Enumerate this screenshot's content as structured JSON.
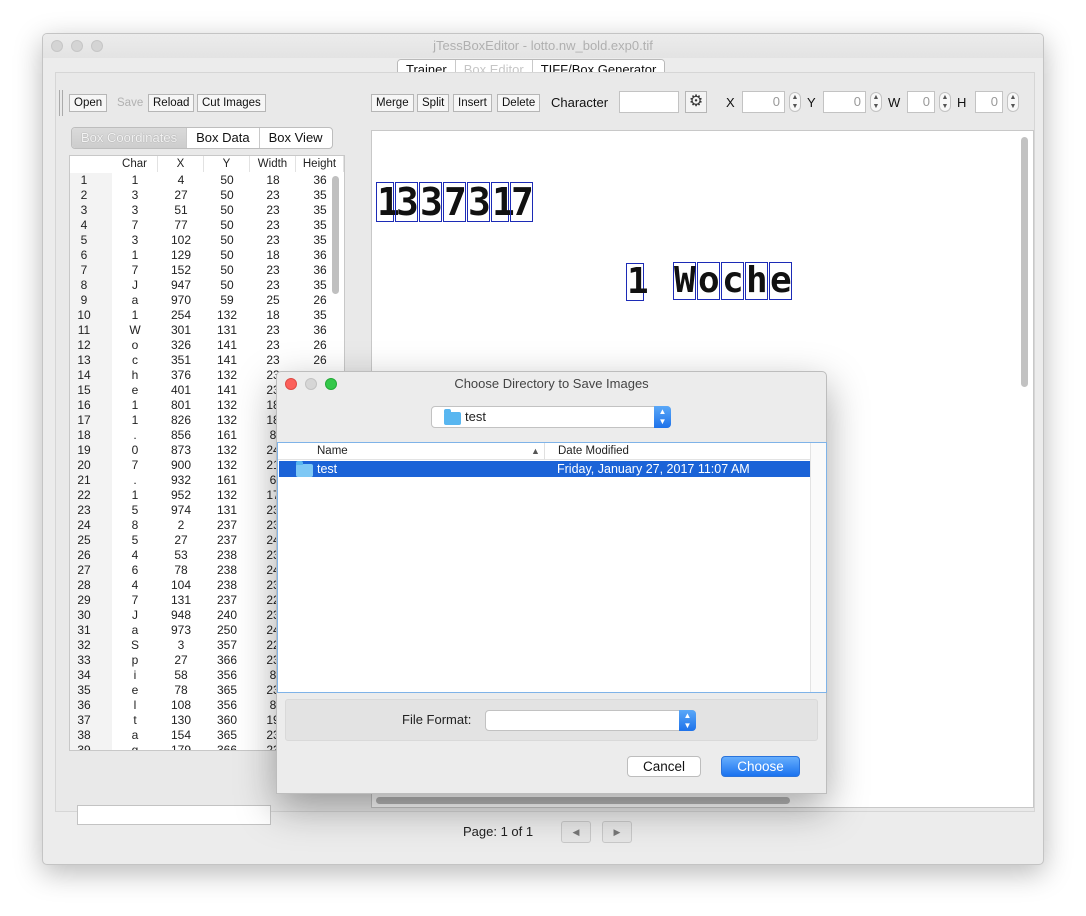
{
  "window": {
    "title": "jTessBoxEditor - lotto.nw_bold.exp0.tif"
  },
  "main_tabs": [
    {
      "label": "Trainer"
    },
    {
      "label": "Box Editor"
    },
    {
      "label": "TIFF/Box Generator"
    }
  ],
  "toolbar": {
    "open": "Open",
    "save": "Save",
    "reload": "Reload",
    "cut_images": "Cut Images",
    "merge": "Merge",
    "split": "Split",
    "insert": "Insert",
    "delete": "Delete",
    "character_label": "Character",
    "character_value": "",
    "settings_icon": "gear-icon",
    "x_label": "X",
    "x_value": "0",
    "y_label": "Y",
    "y_value": "0",
    "w_label": "W",
    "w_value": "0",
    "h_label": "H",
    "h_value": "0"
  },
  "left_tabs": [
    {
      "label": "Box Coordinates"
    },
    {
      "label": "Box Data"
    },
    {
      "label": "Box View"
    }
  ],
  "table": {
    "columns": [
      "Char",
      "X",
      "Y",
      "Width",
      "Height"
    ],
    "rows": [
      [
        "1",
        "1",
        "4",
        "50",
        "18",
        "36"
      ],
      [
        "2",
        "3",
        "27",
        "50",
        "23",
        "35"
      ],
      [
        "3",
        "3",
        "51",
        "50",
        "23",
        "35"
      ],
      [
        "4",
        "7",
        "77",
        "50",
        "23",
        "35"
      ],
      [
        "5",
        "3",
        "102",
        "50",
        "23",
        "35"
      ],
      [
        "6",
        "1",
        "129",
        "50",
        "18",
        "36"
      ],
      [
        "7",
        "7",
        "152",
        "50",
        "23",
        "36"
      ],
      [
        "8",
        "J",
        "947",
        "50",
        "23",
        "35"
      ],
      [
        "9",
        "a",
        "970",
        "59",
        "25",
        "26"
      ],
      [
        "10",
        "1",
        "254",
        "132",
        "18",
        "35"
      ],
      [
        "11",
        "W",
        "301",
        "131",
        "23",
        "36"
      ],
      [
        "12",
        "o",
        "326",
        "141",
        "23",
        "26"
      ],
      [
        "13",
        "c",
        "351",
        "141",
        "23",
        "26"
      ],
      [
        "14",
        "h",
        "376",
        "132",
        "23",
        ""
      ],
      [
        "15",
        "e",
        "401",
        "141",
        "23",
        ""
      ],
      [
        "16",
        "1",
        "801",
        "132",
        "18",
        ""
      ],
      [
        "17",
        "1",
        "826",
        "132",
        "18",
        ""
      ],
      [
        "18",
        ".",
        "856",
        "161",
        "8",
        ""
      ],
      [
        "19",
        "0",
        "873",
        "132",
        "24",
        ""
      ],
      [
        "20",
        "7",
        "900",
        "132",
        "21",
        ""
      ],
      [
        "21",
        ".",
        "932",
        "161",
        "6",
        ""
      ],
      [
        "22",
        "1",
        "952",
        "132",
        "17",
        ""
      ],
      [
        "23",
        "5",
        "974",
        "131",
        "23",
        ""
      ],
      [
        "24",
        "8",
        "2",
        "237",
        "23",
        ""
      ],
      [
        "25",
        "5",
        "27",
        "237",
        "24",
        ""
      ],
      [
        "26",
        "4",
        "53",
        "238",
        "23",
        ""
      ],
      [
        "27",
        "6",
        "78",
        "238",
        "24",
        ""
      ],
      [
        "28",
        "4",
        "104",
        "238",
        "23",
        ""
      ],
      [
        "29",
        "7",
        "131",
        "237",
        "22",
        ""
      ],
      [
        "30",
        "J",
        "948",
        "240",
        "23",
        ""
      ],
      [
        "31",
        "a",
        "973",
        "250",
        "24",
        ""
      ],
      [
        "32",
        "S",
        "3",
        "357",
        "22",
        ""
      ],
      [
        "33",
        "p",
        "27",
        "366",
        "23",
        ""
      ],
      [
        "34",
        "i",
        "58",
        "356",
        "8",
        ""
      ],
      [
        "35",
        "e",
        "78",
        "365",
        "23",
        ""
      ],
      [
        "36",
        "l",
        "108",
        "356",
        "8",
        ""
      ],
      [
        "37",
        "t",
        "130",
        "360",
        "19",
        ""
      ],
      [
        "38",
        "a",
        "154",
        "365",
        "23",
        ""
      ],
      [
        "39",
        "g",
        "179",
        "366",
        "23",
        ""
      ]
    ]
  },
  "image": {
    "line1": [
      "1",
      "3",
      "3",
      "7",
      "3",
      "1",
      "7"
    ],
    "line2a": [
      "1"
    ],
    "line2b": [
      "W",
      "o",
      "c",
      "h",
      "e"
    ]
  },
  "pager": {
    "text": "Page: 1 of 1",
    "prev_icon": "prev-page-icon",
    "next_icon": "next-page-icon"
  },
  "dialog": {
    "title": "Choose Directory to Save Images",
    "directory": "test",
    "col_name": "Name",
    "col_date": "Date Modified",
    "files": [
      {
        "name": "test",
        "date": "Friday, January 27, 2017 11:07 AM"
      }
    ],
    "file_format_label": "File Format:",
    "file_format_value": "",
    "cancel": "Cancel",
    "choose": "Choose"
  },
  "colors": {
    "accent": "#1b63d7",
    "box_outline": "#1c2bb6",
    "close": "#fc605b",
    "minimize": "#fdbc40",
    "zoom": "#34c84a"
  }
}
